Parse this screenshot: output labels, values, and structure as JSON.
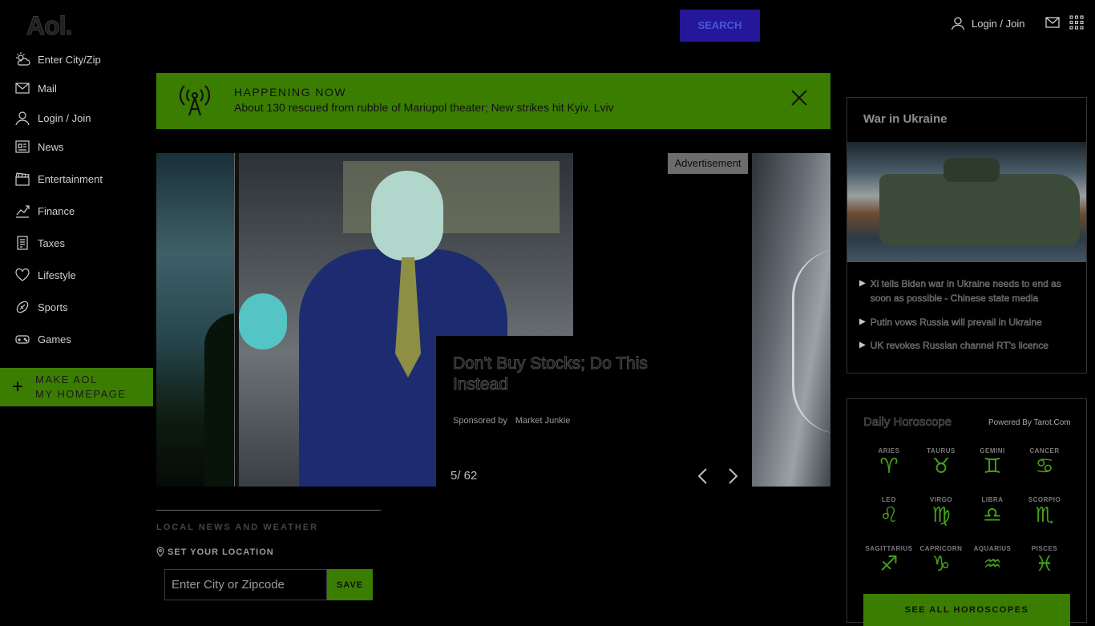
{
  "header": {
    "logo": "Aol.",
    "search_label": "SEARCH",
    "login_label": "Login / Join"
  },
  "sidebar": {
    "items": [
      {
        "label": "Enter City/Zip",
        "icon": "weather-icon"
      },
      {
        "label": "Mail",
        "icon": "mail-icon"
      },
      {
        "label": "Login / Join",
        "icon": "user-icon"
      },
      {
        "label": "News",
        "icon": "news-icon"
      },
      {
        "label": "Entertainment",
        "icon": "clapper-icon"
      },
      {
        "label": "Finance",
        "icon": "chart-icon"
      },
      {
        "label": "Taxes",
        "icon": "taxes-icon"
      },
      {
        "label": "Lifestyle",
        "icon": "heart-icon"
      },
      {
        "label": "Sports",
        "icon": "football-icon"
      },
      {
        "label": "Games",
        "icon": "gamepad-icon"
      }
    ],
    "homepage_line1": "MAKE AOL",
    "homepage_line2": "MY HOMEPAGE"
  },
  "banner": {
    "title": "HAPPENING NOW",
    "text": "About 130 rescued from rubble of Mariupol theater; New strikes hit Kyiv. Lviv"
  },
  "carousel": {
    "ad_label": "Advertisement",
    "caption_title": "Don't Buy Stocks; Do This Instead",
    "sponsored_by": "Sponsored by",
    "sponsor": "Market Junkie",
    "counter": "5/ 62"
  },
  "local_news": {
    "title": "LOCAL NEWS AND WEATHER",
    "set_location": "SET YOUR LOCATION",
    "input_placeholder": "Enter City or Zipcode",
    "save_label": "SAVE"
  },
  "ukraine": {
    "title": "War in Ukraine",
    "headlines": [
      "Xi tells Biden war in Ukraine needs to end as soon as possible - Chinese state media",
      "Putin vows Russia will prevail in Ukraine",
      "UK revokes Russian channel RT's licence"
    ]
  },
  "horoscope": {
    "title": "Daily Horoscope",
    "powered_by": "Powered By Tarot.Com",
    "signs": [
      {
        "name": "ARIES",
        "glyph": "♈"
      },
      {
        "name": "TAURUS",
        "glyph": "♉"
      },
      {
        "name": "GEMINI",
        "glyph": "♊"
      },
      {
        "name": "CANCER",
        "glyph": "♋"
      },
      {
        "name": "LEO",
        "glyph": "♌"
      },
      {
        "name": "VIRGO",
        "glyph": "♍"
      },
      {
        "name": "LIBRA",
        "glyph": "♎"
      },
      {
        "name": "SCORPIO",
        "glyph": "♏"
      },
      {
        "name": "SAGITTARIUS",
        "glyph": "♐"
      },
      {
        "name": "CAPRICORN",
        "glyph": "♑"
      },
      {
        "name": "AQUARIUS",
        "glyph": "♒"
      },
      {
        "name": "PISCES",
        "glyph": "♓"
      }
    ],
    "see_all_label": "SEE ALL HOROSCOPES"
  },
  "colors": {
    "accent_green": "#3b7d00",
    "search_blue": "#24179a"
  }
}
